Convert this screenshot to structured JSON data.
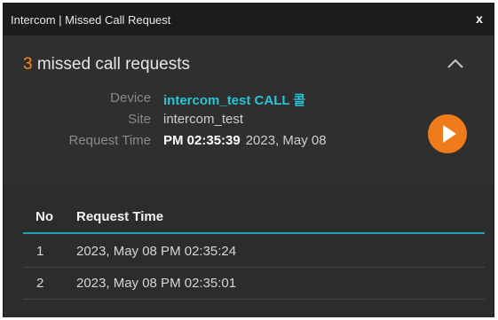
{
  "window": {
    "title": "Intercom | Missed Call Request",
    "close_label": "x"
  },
  "summary": {
    "count": "3",
    "headline_text": "missed call requests",
    "device_label": "Device",
    "device_value": "intercom_test CALL 콜",
    "site_label": "Site",
    "site_value": "intercom_test",
    "request_time_label": "Request Time",
    "request_time_clock": "PM 02:35:39",
    "request_time_date": "2023, May 08"
  },
  "table": {
    "columns": [
      "No",
      "Request Time"
    ],
    "rows": [
      {
        "no": "1",
        "time": "2023, May 08 PM 02:35:24"
      },
      {
        "no": "2",
        "time": "2023, May 08 PM 02:35:01"
      }
    ]
  },
  "colors": {
    "accent_orange": "#f07b1a",
    "accent_cyan": "#25c5d8",
    "header_rule": "#1fa3b5",
    "panel_bg": "#2f2f2f",
    "titlebar_bg": "#1c1c1c"
  },
  "icons": {
    "close": "close-icon",
    "collapse": "chevron-up-icon",
    "play": "play-icon"
  }
}
